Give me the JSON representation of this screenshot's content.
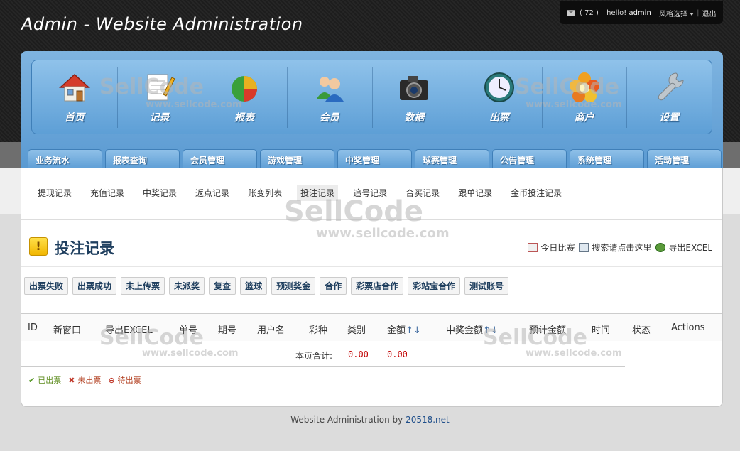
{
  "site_title": "Admin - Website Administration",
  "userbar": {
    "count": "( 72 )",
    "greeting": "hello!",
    "username": "admin",
    "style_select": "风格选择",
    "logout": "退出"
  },
  "icon_nav": [
    {
      "label": "首页",
      "icon": "home-icon"
    },
    {
      "label": "记录",
      "icon": "notepad-icon"
    },
    {
      "label": "报表",
      "icon": "pie-chart-icon"
    },
    {
      "label": "会员",
      "icon": "users-icon"
    },
    {
      "label": "数据",
      "icon": "camera-icon"
    },
    {
      "label": "出票",
      "icon": "clock-icon"
    },
    {
      "label": "商户",
      "icon": "flower-icon"
    },
    {
      "label": "设置",
      "icon": "wrench-icon"
    }
  ],
  "tabs": [
    "业务流水",
    "报表查询",
    "会员管理",
    "游戏管理",
    "中奖管理",
    "球赛管理",
    "公告管理",
    "系统管理",
    "活动管理"
  ],
  "subnav": [
    "提现记录",
    "充值记录",
    "中奖记录",
    "返点记录",
    "账变列表",
    "投注记录",
    "追号记录",
    "合买记录",
    "跟单记录",
    "金币投注记录"
  ],
  "page_title": "投注记录",
  "actions": [
    "今日比赛",
    "搜索请点击这里",
    "导出EXCEL"
  ],
  "filters": [
    "出票失败",
    "出票成功",
    "未上传票",
    "未派奖",
    "复查",
    "篮球",
    "预测奖金",
    "合作",
    "彩票店合作",
    "彩站宝合作",
    "测试账号"
  ],
  "table": {
    "headers": [
      "ID",
      "新窗口",
      "导出EXCEL",
      "单号",
      "期号",
      "用户名",
      "彩种",
      "类别",
      "金额",
      "中奖金额",
      "预计金额",
      "时间",
      "状态",
      "Actions"
    ],
    "sort_arrows": "↑↓",
    "summary_label": "本页合计:",
    "summary_amount": "0.00",
    "summary_prize": "0.00"
  },
  "legend": [
    "已出票",
    "未出票",
    "待出票"
  ],
  "watermark": {
    "brand": "SellCode",
    "url": "www.sellcode.com"
  },
  "footer": {
    "text": "Website Administration by",
    "link": "20518.net"
  }
}
